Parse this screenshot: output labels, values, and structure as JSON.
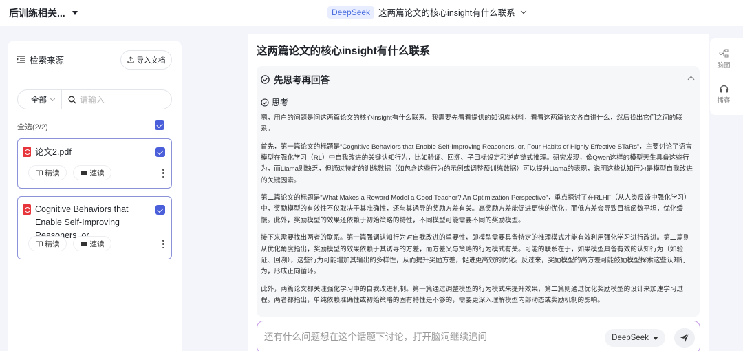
{
  "header": {
    "project_name": "后训练相关...",
    "model_badge": "DeepSeek",
    "conversation_title": "这两篇论文的核心insight有什么联系"
  },
  "sidebar": {
    "title": "检索来源",
    "import_button": "导入文档",
    "filter_select": "全部",
    "search_placeholder": "请输入",
    "select_all": "全选(2/2)",
    "files": [
      {
        "name": "论文2.pdf",
        "intensive_read": "精读",
        "quick_read": "速读"
      },
      {
        "name": "Cognitive Behaviors that Enable Self-Improving Reasoners, or,...",
        "intensive_read": "精读",
        "quick_read": "速读"
      }
    ]
  },
  "main": {
    "question": "这两篇论文的核心insight有什么联系",
    "think_header": "先思考再回答",
    "think_label": "思考",
    "paragraphs": [
      "嗯，用户的问题是问这两篇论文的核心insight有什么联系。我需要先看看提供的知识库材料，看看这两篇论文各自讲什么，然后找出它们之间的联系。",
      "首先，第一篇论文的标题是“Cognitive Behaviors that Enable Self-Improving Reasoners, or, Four Habits of Highly Effective STaRs”，主要讨论了语言模型在强化学习（RL）中自我改进的关键认知行为，比如验证、回溯、子目标设定和逆向链式推理。研究发现，像Qwen这样的模型天生具备这些行为，而Llama则缺乏，但通过特定的训练数据（如包含这些行为的示例或调整预训练数据）可以提升Llama的表现，说明这些认知行为是模型自我改进的关键因素。",
      "第二篇论文的标题是“What Makes a Reward Model a Good Teacher? An Optimization Perspective”，重点探讨了在RLHF（从人类反馈中强化学习）中，奖励模型的有效性不仅取决于其准确性，还与其诱导的奖励方差有关。高奖励方差能促进更快的优化，而低方差会导致目标函数平坦，优化缓慢。此外，奖励模型的效果还依赖于初始策略的特性，不同模型可能需要不同的奖励模型。",
      "接下来需要找出两者的联系。第一篇强调认知行为对自我改进的重要性，即模型需要具备特定的推理模式才能有效利用强化学习进行改进。第二篇则从优化角度指出，奖励模型的效果依赖于其诱导的方差，而方差又与策略的行为模式有关。可能的联系在于，如果模型具备有效的认知行为（如验证、回溯），这些行为可能增加其输出的多样性，从而提升奖励方差，促进更高效的优化。反过来，奖励模型的高方差可能鼓励模型探索这些认知行为，形成正向循环。",
      "此外，两篇论文都关注强化学习中的自我改进机制。第一篇通过调整模型的行为模式来提升效果，第二篇则通过优化奖励模型的设计来加速学习过程。两者都指出，单纯依赖准确性或初始策略的固有特性是不够的，需要更深入理解模型内部动态或奖励机制的影响。"
    ],
    "input_placeholder": "还有什么问题想在这个话题下讨论，打开脑洞继续追问",
    "model_select": "DeepSeek"
  },
  "right_rail": {
    "mindmap_label": "脑图",
    "podcast_label": "播客"
  },
  "colors": {
    "accent": "#4a5fd9",
    "badge_bg": "#e8edff",
    "pdf_red": "#e6353b",
    "card_border": "#8b92d9",
    "input_border": "#c79be8"
  }
}
